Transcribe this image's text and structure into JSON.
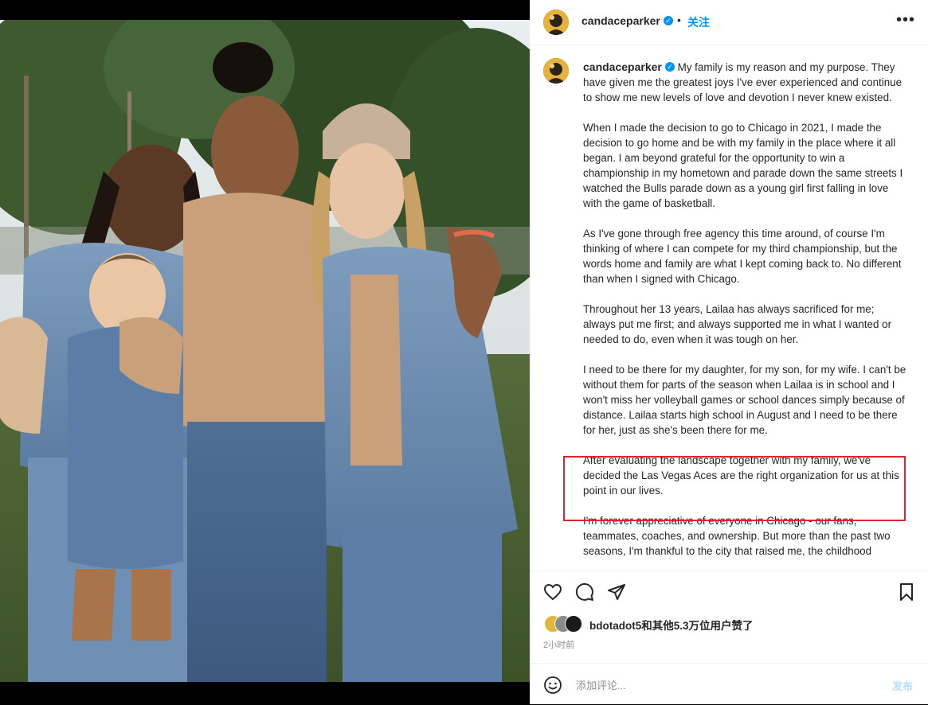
{
  "post": {
    "username": "candaceparker",
    "verified_icon": "verified-badge-icon",
    "dot": "•",
    "follow_label": "关注",
    "more_label": "•••"
  },
  "caption": {
    "username": "candaceparker",
    "paragraphs": [
      "My family is my reason and my purpose. They have given me the greatest joys I've ever experienced and continue to show me new levels of love and devotion I never knew existed.",
      "When I made the decision to go to Chicago in 2021, I made the decision to go home and be with my family in the place where it all began. I am beyond grateful for the opportunity to win a championship in my hometown and parade down the same streets I watched the Bulls parade down as a young girl first falling in love with the game of basketball.",
      "As I've gone through free agency this time around, of course I'm thinking of where I can compete for my third championship, but the words home and family are what I kept coming back to. No different than when I signed with Chicago.",
      "Throughout her 13 years, Lailaa has always sacrificed for me; always put me first; and always supported me in what I wanted or needed to do, even when it was tough on her.",
      "I need to be there for my daughter, for my son, for my wife. I can't be without them for parts of the season when Lailaa is in school and I won't miss her volleyball games or school dances simply because of distance. Lailaa starts high school in August and I need to be there for her, just as she's been there for me.",
      "After evaluating the landscape together with my family, we've decided the Las Vegas Aces are the right organization for us at this point in our lives.",
      "I'm forever appreciative of everyone in Chicago - our fans, teammates, coaches, and ownership. But more than the past two seasons, I'm thankful to the city that raised me, the childhood"
    ]
  },
  "actions": {
    "like_icon": "heart-icon",
    "comment_icon": "comment-icon",
    "share_icon": "share-icon",
    "save_icon": "bookmark-icon"
  },
  "likes": {
    "text": "bdotadot5和其他5.3万位用户赞了"
  },
  "time": "2小时前",
  "comment": {
    "emoji_icon": "emoji-icon",
    "placeholder": "添加评论...",
    "post_label": "发布"
  },
  "colors": {
    "accent": "#0095f6",
    "highlight": "#d9262f",
    "post_disabled": "#b2dffc"
  }
}
